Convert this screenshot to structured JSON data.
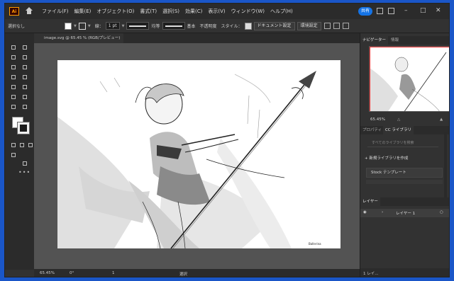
{
  "menubar": {
    "app_logo": "Ai",
    "items": [
      "ファイル(F)",
      "編集(E)",
      "オブジェクト(O)",
      "書式(T)",
      "選択(S)",
      "効果(C)",
      "表示(V)",
      "ウィンドウ(W)",
      "ヘルプ(H)"
    ],
    "share_label": "共有",
    "accent_color": "#1473e6"
  },
  "controlbar": {
    "selection": "選択なし",
    "stroke_label": "線：",
    "stroke_weight": "1 pt",
    "uniform_label": "均等",
    "basic_label": "基本",
    "opacity_label": "不透明度",
    "style_label": "スタイル：",
    "doc_setup_button": "ドキュメント設定",
    "prefs_button": "環境設定"
  },
  "document": {
    "tab_title": "image.svg @ 65.45 % (RGB/プレビュー)",
    "close_glyph": "×",
    "signature": "Ballerina"
  },
  "status": {
    "zoom": "65.45%",
    "rotation": "0°",
    "artboard": "1",
    "tool": "選択"
  },
  "navigator": {
    "tabs": [
      "ナビゲーター",
      "情報"
    ],
    "zoom": "65.45%"
  },
  "library": {
    "tabs": [
      "プロパティ",
      "CC ライブラリ"
    ],
    "search_placeholder": "すべてのライブラリを検索",
    "new_library": "新規ライブラリを作成",
    "stock_item": "Stock テンプレート"
  },
  "layers": {
    "tab": "レイヤー",
    "layer_name": "レイヤー 1",
    "footer": "1 レイ..."
  }
}
